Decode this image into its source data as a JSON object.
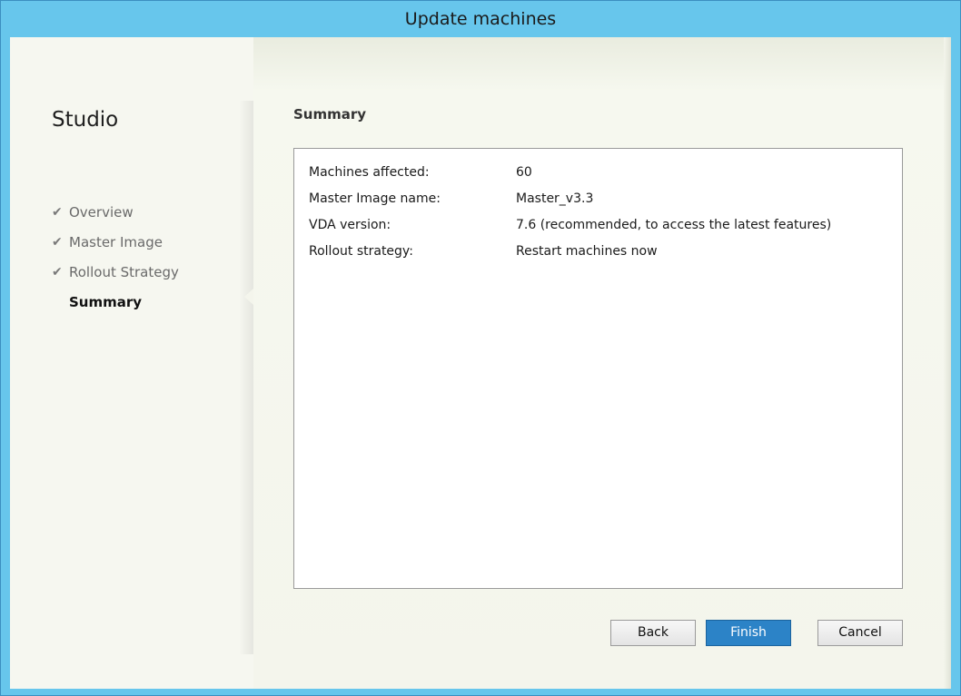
{
  "window": {
    "title": "Update machines"
  },
  "sidebar": {
    "app_title": "Studio",
    "steps": [
      {
        "label": "Overview",
        "completed": true
      },
      {
        "label": "Master Image",
        "completed": true
      },
      {
        "label": "Rollout Strategy",
        "completed": true
      },
      {
        "label": "Summary",
        "completed": false,
        "current": true
      }
    ],
    "check_glyph": "✔"
  },
  "main": {
    "section_title": "Summary",
    "rows": [
      {
        "label": "Machines affected:",
        "value": "60"
      },
      {
        "label": "Master Image name:",
        "value": "Master_v3.3"
      },
      {
        "label": "VDA version:",
        "value": "7.6 (recommended, to access the latest features)"
      },
      {
        "label": "Rollout strategy:",
        "value": "Restart machines now"
      }
    ]
  },
  "buttons": {
    "back": "Back",
    "finish": "Finish",
    "cancel": "Cancel"
  },
  "colors": {
    "titlebar": "#67c6ec",
    "primary_button": "#2c83c7"
  }
}
